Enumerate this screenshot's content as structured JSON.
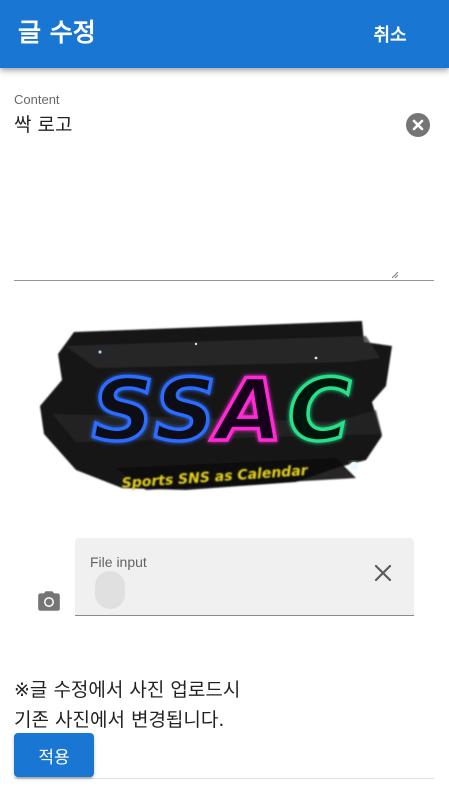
{
  "header": {
    "title": "글 수정",
    "cancel_label": "취소",
    "bg_color": "#1976d2"
  },
  "content_field": {
    "label": "Content",
    "value": "싹 로고",
    "clear_icon": "close-circle-icon"
  },
  "image": {
    "logo_main_text": "SSAC",
    "logo_sub_text": "Sports SNS as Calendar"
  },
  "file_input": {
    "label": "File input",
    "prepend_icon": "camera-icon",
    "clear_icon": "close-icon"
  },
  "notice": {
    "line1": "※글 수정에서 사진 업로드시",
    "line2": "기존 사진에서 변경됩니다."
  },
  "actions": {
    "apply_label": "적용"
  }
}
